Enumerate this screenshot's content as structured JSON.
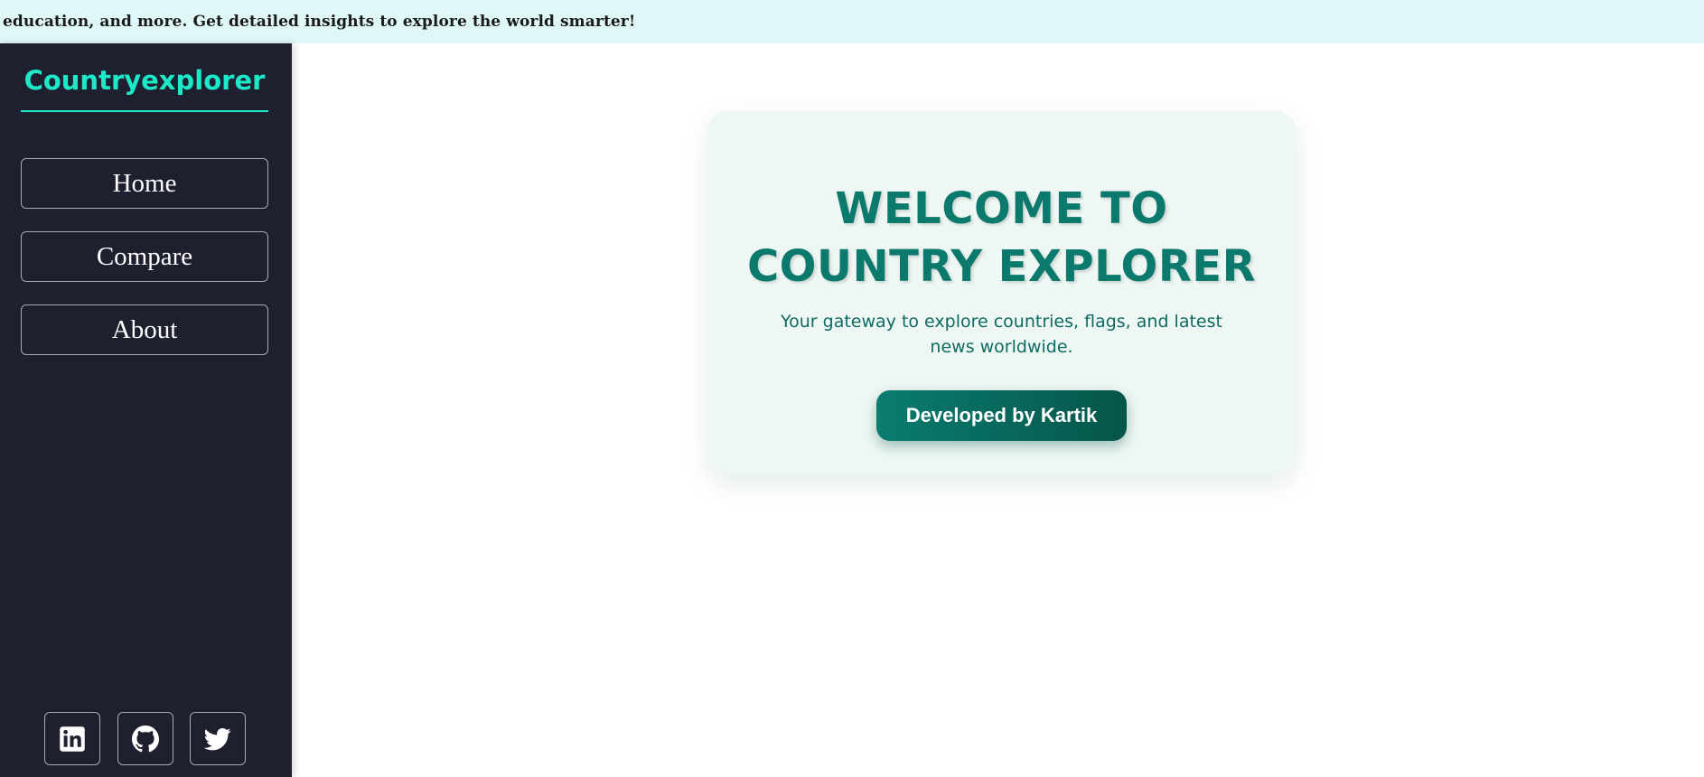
{
  "ticker": {
    "text": "education, and more. Get detailed insights to explore the world smarter!"
  },
  "sidebar": {
    "brand": "Countryexplorer",
    "nav": [
      {
        "label": "Home"
      },
      {
        "label": "Compare"
      },
      {
        "label": "About"
      }
    ],
    "social": [
      {
        "icon": "linkedin-icon"
      },
      {
        "icon": "github-icon"
      },
      {
        "icon": "twitter-icon"
      }
    ]
  },
  "hero": {
    "title": "WELCOME TO COUNTRY EXPLORER",
    "subtitle": "Your gateway to explore countries, flags, and latest news worldwide.",
    "button_label": "Developed by Kartik"
  },
  "colors": {
    "sidebar_bg": "#1e1f2f",
    "brand_accent": "#1de9c8",
    "ticker_bg": "#e0f7f8",
    "hero_title": "#0b7a6d",
    "hero_button": "#0a7c70"
  }
}
